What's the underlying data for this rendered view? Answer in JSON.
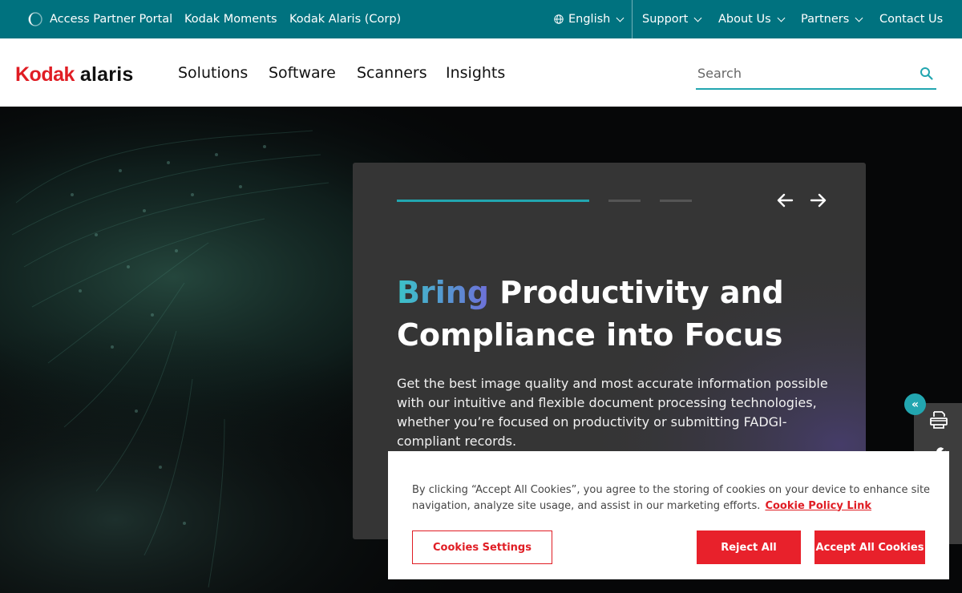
{
  "utility_bar": {
    "left_links": [
      "Access Partner Portal",
      "Kodak Moments",
      "Kodak Alaris (Corp)"
    ],
    "language": "English",
    "right_menus": [
      "Support",
      "About Us",
      "Partners"
    ],
    "contact": "Contact Us"
  },
  "logo": {
    "brand": "Kodak",
    "product": "alaris"
  },
  "nav": [
    "Solutions",
    "Software",
    "Scanners",
    "Insights"
  ],
  "search": {
    "placeholder": "Search",
    "value": ""
  },
  "hero": {
    "headline_highlight": "Bring",
    "headline_rest": " Productivity and Compliance into Focus",
    "description": "Get the best image quality and most accurate information possible with our intuitive and flexible document processing technologies, whether you’re focused on productivity or submitting FADGI-compliant records.",
    "carousel_slides": 3,
    "active_slide": 1
  },
  "side_toolbar": {
    "toggle_glyph": "«",
    "icons": [
      "scanner-icon",
      "wrench-icon",
      "help-icon",
      "monitor-icon"
    ]
  },
  "cookie_banner": {
    "text": "By clicking “Accept All Cookies”, you agree to the storing of cookies on your device to enhance site navigation, analyze site usage, and assist in our marketing efforts.",
    "policy_link": "Cookie Policy Link",
    "settings_button": "Cookies Settings",
    "reject_button": "Reject All",
    "accept_button": "Accept All Cookies"
  },
  "colors": {
    "utility_bar": "#00727f",
    "accent_teal": "#22a6b0",
    "brand_red": "#e01d24",
    "card_bg": "#353535"
  }
}
